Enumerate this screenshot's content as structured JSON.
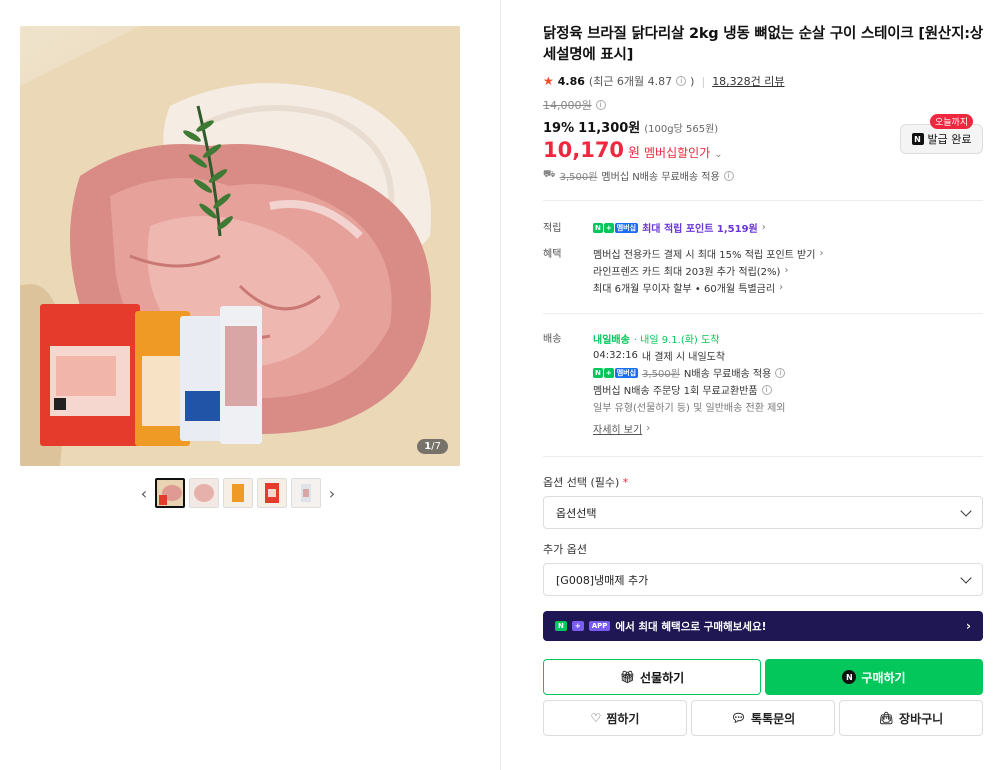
{
  "gallery": {
    "counter_current": "1",
    "counter_total": "/7",
    "thumb_prev": "‹",
    "thumb_next": "›"
  },
  "product": {
    "title": "닭정육 브라질 닭다리살 2kg 냉동 뼈없는 순살 구이 스테이크 [원산지:상세설명에 표시]",
    "rating_score": "4.86",
    "rating_recent": "(최근 6개월 4.87",
    "rating_recent_close": ")",
    "review_count": "18,328건 리뷰",
    "original_price": "14,000원",
    "discount_rate": "19%",
    "sale_price": "11,300원",
    "unit_price": "(100g당 565원)",
    "member_price": "10,170",
    "member_won": "원",
    "member_label": "멤버십할인가",
    "ship_strike": "3,500원",
    "ship_text": "멤버십 N배송 무료배송 적용"
  },
  "coupon": {
    "badge": "오늘까지",
    "label": "발급 완료"
  },
  "benefits": {
    "point_label": "적립",
    "point_text": "최대 적립 포인트 1,519원",
    "benefit_label": "혜택",
    "lines": [
      "멤버십 전용카드 결제 시 최대 15% 적립 포인트 받기",
      "라인프렌즈 카드 최대 203원 추가 적립(2%)",
      "최대 6개월 무이자 할부 • 60개월 특별금리"
    ]
  },
  "delivery": {
    "label": "배송",
    "tomorrow_tag": "내일배송",
    "arrival": "· 내일 9.1.(화) 도착",
    "cutoff_time": "04:32:16",
    "cutoff_text": "내 결제 시 내일도착",
    "free_strike": "3,500원",
    "free_text": "N배송 무료배송 적용",
    "return_text": "멤버십 N배송 주문당 1회 무료교환반품",
    "exclude_text": "일부 유형(선물하기 등) 및 일반배송 전환 제외",
    "detail_link": "자세히 보기"
  },
  "options": {
    "required_label": "옵션 선택 (필수)",
    "required_mark": "*",
    "required_value": "옵션선택",
    "extra_label": "추가 옵션",
    "extra_value": "[G008]냉매제 추가"
  },
  "npay_tags": {
    "n": "N",
    "plus": "+",
    "membership": "멤버십",
    "app": "APP"
  },
  "banner": {
    "text": "에서 최대 혜택으로 구매해보세요!"
  },
  "buttons": {
    "gift": "선물하기",
    "buy": "구매하기",
    "wish": "찜하기",
    "talk": "톡톡문의",
    "cart": "장바구니"
  },
  "colors": {
    "accent_green": "#03c75a",
    "sale_red": "#f0273f",
    "banner_navy": "#1e1753"
  }
}
